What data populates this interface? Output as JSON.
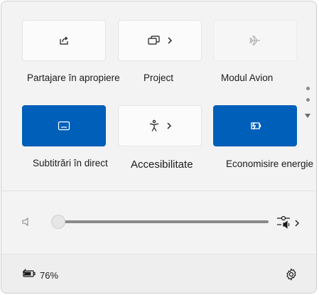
{
  "tiles": [
    {
      "label": "Partajare în apropiere",
      "icon": "share-icon",
      "state": "off"
    },
    {
      "label": "Project",
      "icon": "project-icon",
      "state": "off",
      "chevron": true
    },
    {
      "label": "Modul Avion",
      "icon": "airplane-icon",
      "state": "disabled"
    },
    {
      "label": "Subtitrări în direct",
      "icon": "captions-icon",
      "state": "on"
    },
    {
      "label": "Accesibilitate",
      "icon": "accessibility-icon",
      "state": "off",
      "chevron": true
    },
    {
      "label": "Economisire energie",
      "icon": "energy-saver-icon",
      "state": "on"
    }
  ],
  "volume": {
    "level": 0,
    "icon": "speaker-icon",
    "output_icon": "audio-output-icon"
  },
  "battery": {
    "percent": "76%",
    "icon": "battery-charging-icon"
  },
  "settings": {
    "icon": "gear-icon"
  },
  "colors": {
    "accent": "#005fb8",
    "panel": "#f3f3f3",
    "tile": "#fbfbfb"
  }
}
